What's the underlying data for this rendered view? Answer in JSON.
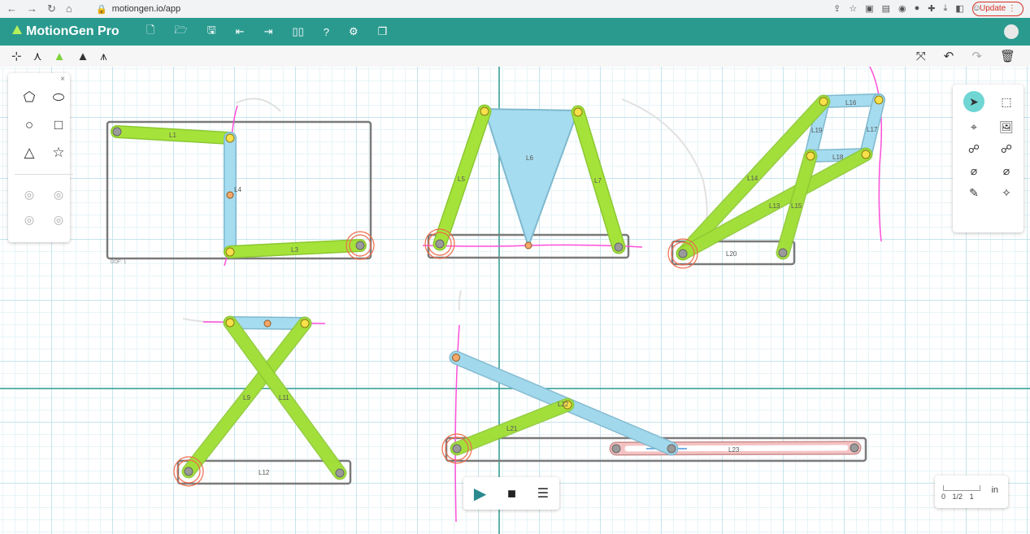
{
  "browser": {
    "url": "motiongen.io/app",
    "update_label": "Update"
  },
  "app": {
    "name": "MotionGen Pro",
    "menu_icons": [
      "new-file-icon",
      "open-folder-icon",
      "save-icon",
      "import-icon",
      "export-icon",
      "book-icon",
      "help-icon",
      "settings-icon",
      "window-icon"
    ]
  },
  "toolbar": {
    "left_icons": [
      "axes-icon",
      "dyad-icon",
      "triad-green-icon",
      "triad-dark-icon",
      "triad-hatched-icon"
    ],
    "right_icons": [
      "fit-screen-icon",
      "undo-icon",
      "redo-icon",
      "trash-icon"
    ]
  },
  "shape_panel": {
    "close": "×",
    "tools": [
      "freeform-icon",
      "blob-icon",
      "circle-icon",
      "square-icon",
      "triangle-icon",
      "star-icon",
      "link-joint-icon",
      "link-joint-alt-icon",
      "gear-icon",
      "gear-alt-icon"
    ]
  },
  "right_panel": {
    "tools": [
      "select-icon",
      "box-select-icon",
      "path-select-icon",
      "image-icon",
      "link-icon",
      "link-alt-icon",
      "add-joint-icon",
      "add-joint-alt-icon",
      "brush-icon",
      "magic-icon"
    ]
  },
  "playback": {
    "play": "▶",
    "stop": "■",
    "settings": "☰"
  },
  "scale": {
    "ticks": [
      "0",
      "1/2",
      "1"
    ],
    "unit": "in"
  },
  "mechanism": {
    "dof_label": "DOF: 1",
    "links": [
      "L1",
      "L3",
      "L4",
      "L5",
      "L6",
      "L7",
      "L9",
      "L11",
      "L12",
      "L13",
      "L14",
      "L15",
      "L16",
      "L17",
      "L18",
      "L19",
      "L20",
      "L21",
      "L22",
      "L23"
    ],
    "colors": {
      "grid_major": "#c8e4ee",
      "axis": "#2a9a8f",
      "link_green": "#a6e33a",
      "link_blue": "#a6dcef",
      "link_pink": "#f4c2c2",
      "joint_yellow": "#f7e04a",
      "joint_gray": "#9a9a9a",
      "path_magenta": "#ff4fd8",
      "ground_red": "#ef6c4c",
      "frame_gray": "#6b6b6b"
    }
  }
}
